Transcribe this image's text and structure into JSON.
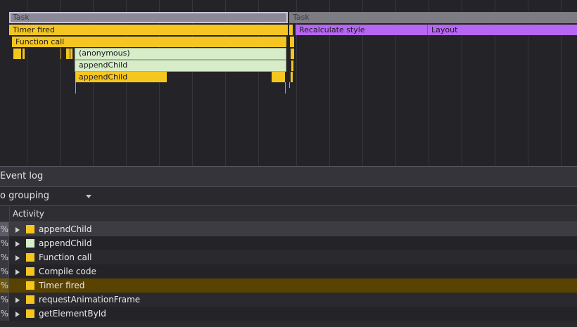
{
  "flame": {
    "task_left": "Task",
    "task_right": "Task",
    "timer_fired": "Timer fired",
    "function_call": "Function call",
    "anonymous": "(anonymous)",
    "append_child_1": "appendChild",
    "append_child_2": "appendChild",
    "recalculate_style": "Recalculate style",
    "layout": "Layout"
  },
  "panel": {
    "title": "Event log",
    "grouping": "o grouping",
    "column_activity": "Activity",
    "rows": [
      {
        "pct": "%",
        "label": "appendChild",
        "swatch": "#f6c620",
        "expandable": true
      },
      {
        "pct": "%",
        "label": "appendChild",
        "swatch": "#d7ecc8",
        "expandable": true
      },
      {
        "pct": "%",
        "label": "Function call",
        "swatch": "#f6c620",
        "expandable": true
      },
      {
        "pct": "%",
        "label": "Compile code",
        "swatch": "#f6c620",
        "expandable": true
      },
      {
        "pct": "%",
        "label": "Timer fired",
        "swatch": "#f6c620",
        "expandable": false
      },
      {
        "pct": "%",
        "label": "requestAnimationFrame",
        "swatch": "#f6c620",
        "expandable": true
      },
      {
        "pct": "%",
        "label": "getElementById",
        "swatch": "#f6c620",
        "expandable": true
      }
    ]
  },
  "colors": {
    "scripting": "#f6c620",
    "rendering": "#b766f4",
    "dom": "#d7ecc8",
    "selected_row": "#5a4300"
  }
}
